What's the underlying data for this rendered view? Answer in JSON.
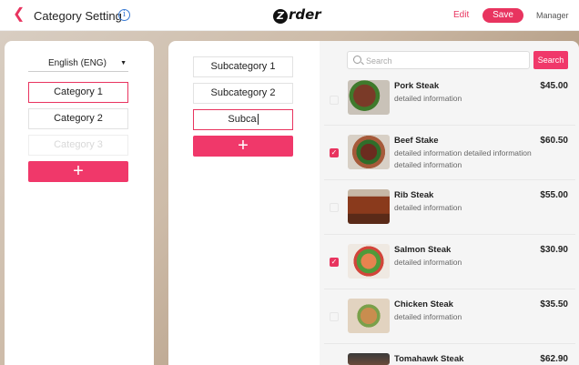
{
  "header": {
    "back_icon": "chevron-left-icon",
    "title": "Category Setting",
    "info_icon": "info-icon",
    "logo": "rder",
    "logo_letter": "Z",
    "edit_label": "Edit",
    "save_label": "Save",
    "manager_label": "Manager"
  },
  "colors": {
    "accent": "#e8345f"
  },
  "categories_panel": {
    "language": "English (ENG)",
    "items": [
      {
        "label": "Category 1",
        "state": "active"
      },
      {
        "label": "Category 2",
        "state": "normal"
      },
      {
        "label": "Category 3",
        "state": "placeholder"
      }
    ],
    "add_label": "+"
  },
  "subcategories_panel": {
    "items": [
      {
        "label": "Subcategory 1"
      },
      {
        "label": "Subcategory 2"
      }
    ],
    "editing_value": "Subca",
    "add_label": "+"
  },
  "products_panel": {
    "search_placeholder": "Search",
    "search_button": "Search",
    "items": [
      {
        "name": "Pork Steak",
        "desc": "detailed information",
        "price": "$45.00",
        "checked": false
      },
      {
        "name": "Beef Stake",
        "desc": "detailed information detailed information detailed information",
        "price": "$60.50",
        "checked": true
      },
      {
        "name": "Rib Steak",
        "desc": "detailed information",
        "price": "$55.00",
        "checked": false
      },
      {
        "name": "Salmon Steak",
        "desc": "detailed information",
        "price": "$30.90",
        "checked": true
      },
      {
        "name": "Chicken Steak",
        "desc": "detailed information",
        "price": "$35.50",
        "checked": false
      },
      {
        "name": "Tomahawk Steak",
        "desc": "",
        "price": "$62.90",
        "checked": false
      }
    ]
  }
}
